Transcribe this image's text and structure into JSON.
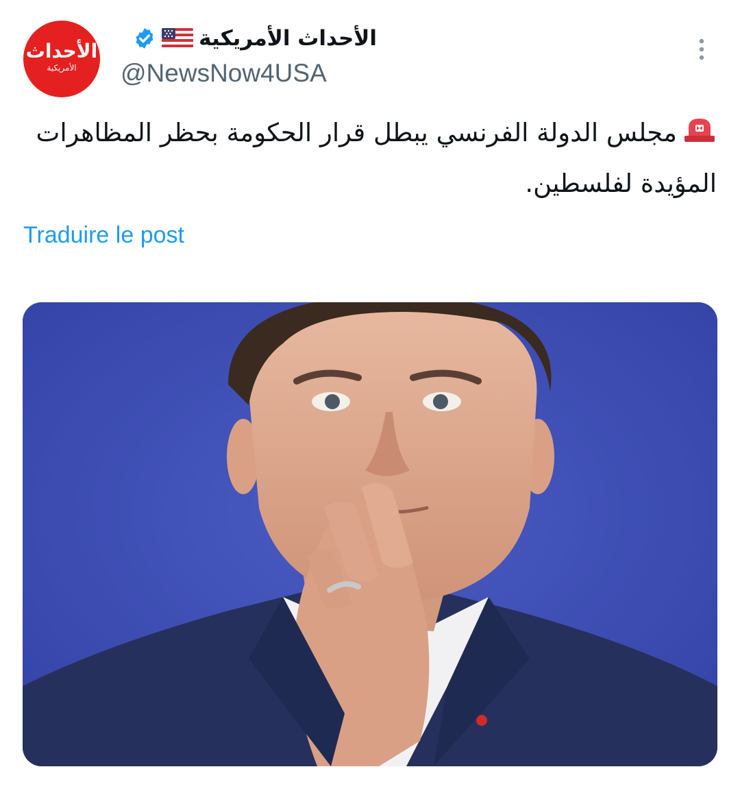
{
  "header": {
    "avatar": {
      "line1": "الأحداث",
      "line2": "الأمريكية",
      "color": "#e52020"
    },
    "display_name": "الأحداث الأمريكية",
    "flag_icon": "us-flag-icon",
    "verified_icon": "verified-badge-icon",
    "verified_color": "#1d9bf0",
    "handle": "@NewsNow4USA",
    "more_icon": "more-vertical-icon"
  },
  "post": {
    "emoji_icon": "police-siren-icon",
    "text": "مجلس الدولة الفرنسي يبطل قرار الحكومة بحظر المظاهرات المؤيدة لفلسطين."
  },
  "translate_link": "Traduire le post",
  "media": {
    "icon": "photo-of-man-icon",
    "background_color": "#3f4fb2"
  },
  "colors": {
    "text": "#0f1419",
    "secondary": "#536471",
    "link": "#1d9bf0"
  }
}
